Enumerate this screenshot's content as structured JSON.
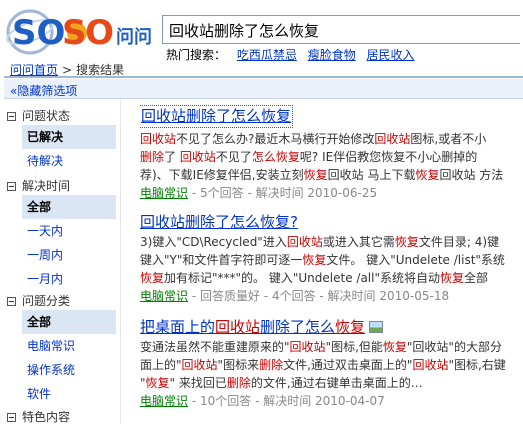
{
  "header": {
    "search_value": "回收站删除了怎么恢复",
    "hot_label": "热门搜索：",
    "hot_links": [
      "吃西瓜禁忌",
      "瘦脸食物",
      "居民收入"
    ]
  },
  "logo": {
    "text_so1": "SO",
    "text_so2": "SO",
    "text_wen": "问问"
  },
  "breadcrumb": {
    "home": "问问首页",
    "separator": ">",
    "current": "搜索结果"
  },
  "filter_toggle": "«隐藏筛选项",
  "sidebar": {
    "groups": [
      {
        "title": "问题状态",
        "options": [
          "已解决",
          "待解决"
        ],
        "selected": 0
      },
      {
        "title": "解决时间",
        "options": [
          "全部",
          "一天内",
          "一周内",
          "一月内"
        ],
        "selected": 0
      },
      {
        "title": "问题分类",
        "options": [
          "全部",
          "电脑常识",
          "操作系统",
          "软件"
        ],
        "selected": 0
      },
      {
        "title": "特色内容",
        "options": []
      }
    ]
  },
  "results": [
    {
      "title": [
        "回收站删除了怎么恢复"
      ],
      "lines": [
        [
          "",
          "回收站",
          "不见了怎么办?最近木马横行开始修改",
          "回收站",
          "图标,或者不小"
        ],
        [
          "",
          "删除",
          "了 ",
          "回收站",
          "不见了",
          "怎么恢复",
          "呢? IE伴侣教您恢复不小心删掉的"
        ],
        [
          "荐)、下载IE修复伴侣,安装立刻",
          "恢复",
          "回收站 马上下载",
          "恢复",
          "回收站 方法"
        ]
      ],
      "category": "电脑常识",
      "meta": "- 5个回答 - 解决时间 2010-06-25"
    },
    {
      "title": [
        "回收站删除了怎么恢复?"
      ],
      "lines": [
        [
          "3)键入\"CD\\Recycled\"进入",
          "回收站",
          "或进入其它需",
          "恢复",
          "文件目录; 4)键"
        ],
        [
          "键入\"Y\"和文件首字符即可逐一",
          "恢复",
          "文件。 键入\"Undelete /list\"系统"
        ],
        [
          "",
          "恢复",
          "加有标记\"***\"的。 键入\"Undelete /all\"系统将自动",
          "恢复",
          "全部"
        ]
      ],
      "category": "电脑常识",
      "meta": "- 回答质量好 - 4个回答 - 解决时间 2010-05-18"
    },
    {
      "title": [
        "把桌面上的",
        "回收站",
        "删除了怎么",
        "恢复"
      ],
      "lines": [
        [
          "变通法虽然不能重建原来的\"",
          "回收站",
          "\"图标,但能",
          "恢复",
          "\"回收站\"的大部分"
        ],
        [
          "面上的\"",
          "回收站",
          "\"图标来",
          "删除",
          "文件,通过双击桌面上的\"",
          "回收站",
          "\"图标,右键"
        ],
        [
          "\"",
          "恢复",
          "\" 来找回已",
          "删除",
          "的文件,通过右键单击桌面上的…"
        ]
      ],
      "category": "电脑常识",
      "meta": "- 10个回答 - 解决时间 2010-04-07"
    }
  ]
}
